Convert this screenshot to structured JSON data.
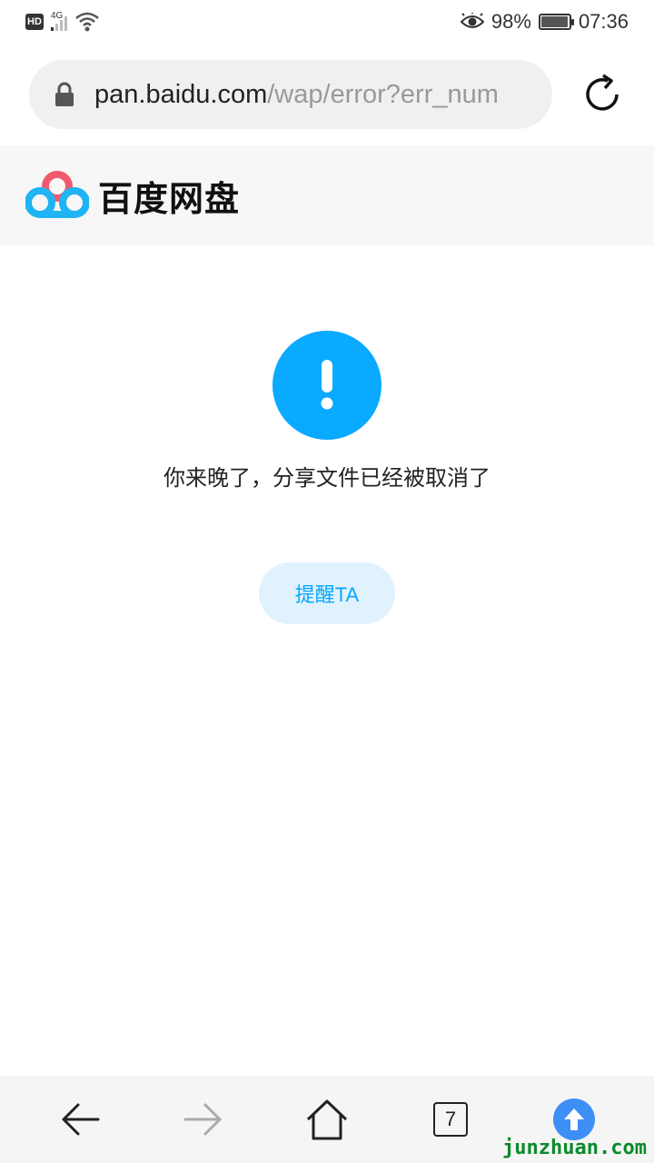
{
  "status_bar": {
    "hd_label": "HD",
    "network_type": "4G",
    "battery_percent": "98%",
    "battery_level": 0.98,
    "time": "07:36",
    "icons": [
      "eye-comfort-icon",
      "battery-icon",
      "wifi-icon",
      "signal-icon"
    ]
  },
  "address_bar": {
    "url_host": "pan.baidu.com",
    "url_path": "/wap/error?err_num"
  },
  "site_header": {
    "logo_text": "百度网盘"
  },
  "content": {
    "error_message": "你来晚了，分享文件已经被取消了",
    "remind_button": "提醒TA"
  },
  "bottom_nav": {
    "tab_count": "7"
  },
  "watermark": "junzhuan.com",
  "colors": {
    "accent": "#09aaff",
    "button_bg": "#e0f2fd",
    "upload_blue": "#3d8ff5",
    "watermark_green": "#0a8a2a"
  }
}
